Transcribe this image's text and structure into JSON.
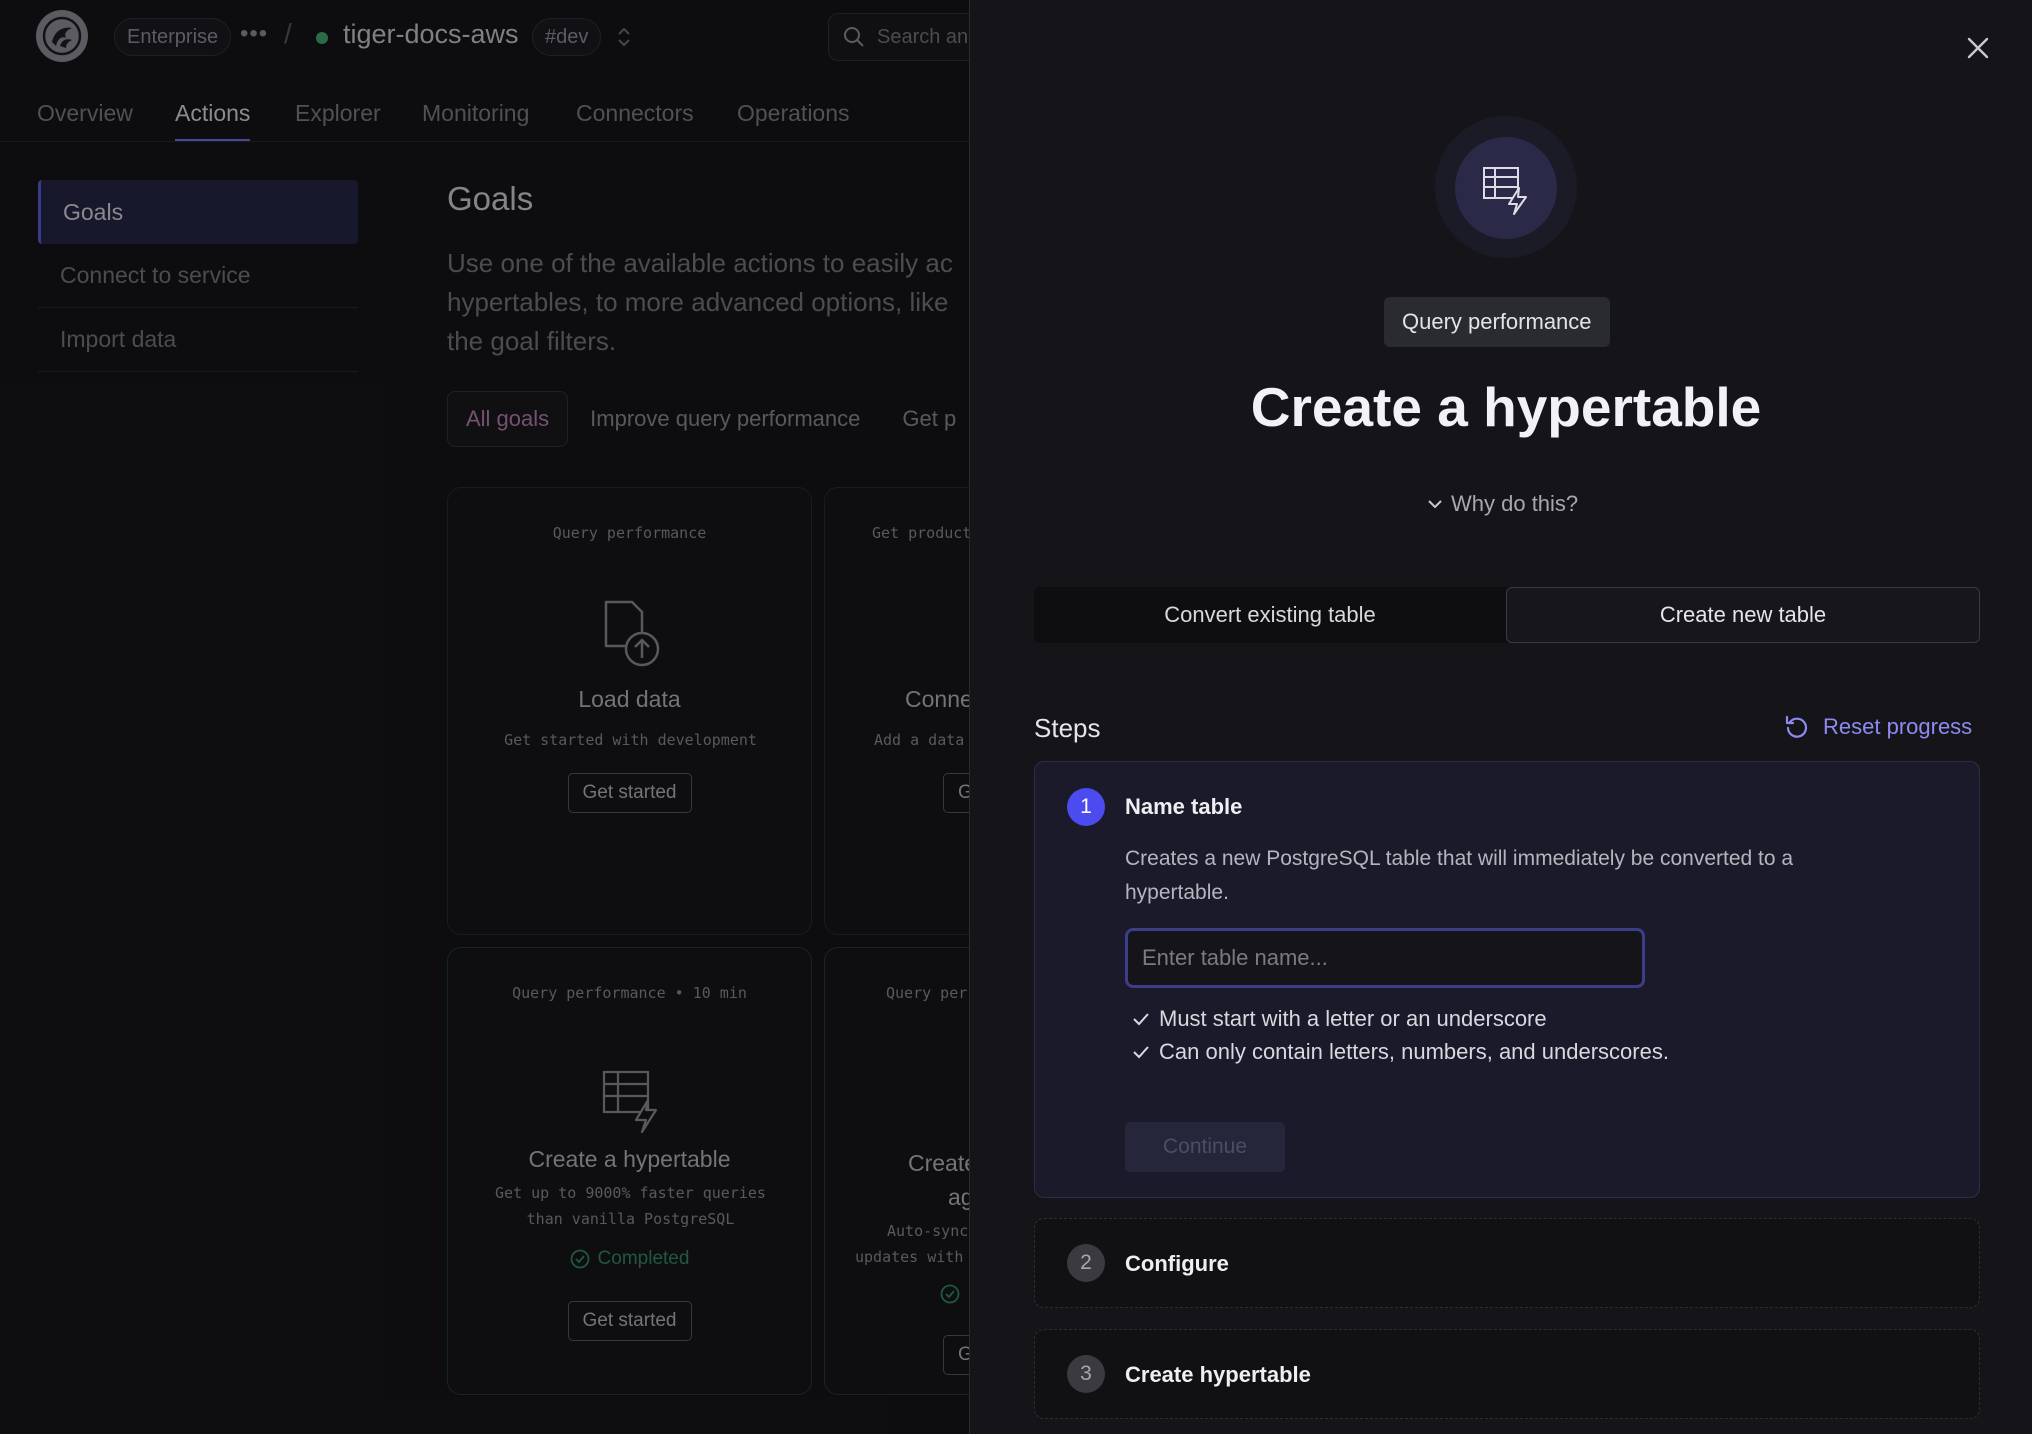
{
  "header": {
    "org_badge": "Enterprise",
    "more_glyph": "•••",
    "separator": "/",
    "project_name": "tiger-docs-aws",
    "env_badge": "#dev",
    "search_placeholder": "Search an",
    "status_color": "#3fa870"
  },
  "tabs": [
    {
      "label": "Overview",
      "active": false
    },
    {
      "label": "Actions",
      "active": true
    },
    {
      "label": "Explorer",
      "active": false
    },
    {
      "label": "Monitoring",
      "active": false
    },
    {
      "label": "Connectors",
      "active": false
    },
    {
      "label": "Operations",
      "active": false
    }
  ],
  "sidebar": {
    "items": [
      {
        "label": "Goals",
        "active": true
      },
      {
        "label": "Connect to service",
        "active": false
      },
      {
        "label": "Import data",
        "active": false
      }
    ]
  },
  "main": {
    "title": "Goals",
    "description_lines": [
      "Use one of the available actions to easily ac",
      "hypertables, to more advanced options, like",
      "the goal filters."
    ],
    "filters": [
      "All goals",
      "Improve query performance",
      "Get p"
    ],
    "cards": [
      {
        "category": "Query performance",
        "icon": "upload-file-icon",
        "title": "Load data",
        "desc": "Get started with development",
        "button": "Get started"
      },
      {
        "category": "Get product",
        "icon": "",
        "title": "Conne",
        "desc": "Add a data",
        "button": "G"
      },
      {
        "category": "Query performance • 10 min",
        "icon": "hypertable-icon",
        "title": "Create a hypertable",
        "desc_lines": [
          "Get up to 9000% faster queries",
          "than vanilla PostgreSQL"
        ],
        "status": "Completed",
        "button": "Get started"
      },
      {
        "category": "Query per",
        "icon": "",
        "title_lines": [
          "Create",
          "ag"
        ],
        "desc_lines": [
          "Auto-sync",
          "updates with"
        ],
        "button": "G"
      }
    ]
  },
  "drawer": {
    "hero_icon": "hypertable-icon",
    "tag": "Query performance",
    "title": "Create a hypertable",
    "why_label": "Why do this?",
    "segments": [
      {
        "label": "Convert existing table",
        "active": false
      },
      {
        "label": "Create new table",
        "active": true
      }
    ],
    "steps_label": "Steps",
    "reset_label": "Reset progress",
    "accent_color": "#4b4bf0",
    "steps": [
      {
        "number": "1",
        "title": "Name table",
        "desc": "Creates a new PostgreSQL table that will immediately be converted to a hypertable.",
        "input_placeholder": "Enter table name...",
        "input_value": "",
        "rules": [
          "Must start with a letter or an underscore",
          "Can only contain letters, numbers, and underscores."
        ],
        "continue_label": "Continue"
      },
      {
        "number": "2",
        "title": "Configure"
      },
      {
        "number": "3",
        "title": "Create hypertable"
      }
    ]
  }
}
